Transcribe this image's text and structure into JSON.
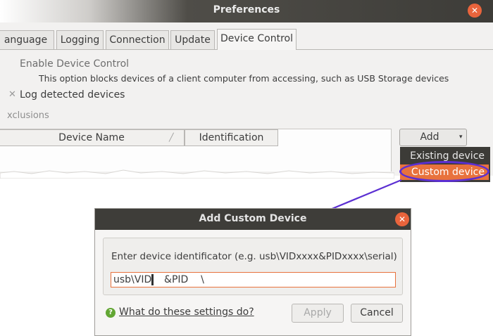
{
  "preferences": {
    "title": "Preferences",
    "close_glyph": "✕",
    "tabs": [
      {
        "label": "anguage"
      },
      {
        "label": "Logging"
      },
      {
        "label": "Connection"
      },
      {
        "label": "Update"
      },
      {
        "label": "Device Control",
        "active": true
      }
    ],
    "enable_label": "Enable Device Control",
    "enable_description": "This option blocks devices of a client computer from accessing, such as USB Storage devices",
    "log_checkbox_glyph": "✕",
    "log_label": "Log detected devices",
    "exclusions_label": "xclusions",
    "table_columns": [
      "Device Name",
      "Identification"
    ],
    "sort_glyph": "╱",
    "add_button": {
      "label": "Add",
      "caret": "▾"
    },
    "add_menu": {
      "items": [
        "Existing device",
        "Custom device"
      ],
      "highlighted": "Custom device"
    }
  },
  "dialog": {
    "title": "Add Custom Device",
    "close_glyph": "✕",
    "prompt": "Enter device identificator (e.g. usb\\VIDxxxx&PIDxxxx\\serial)",
    "input_value": "usb\\VID    &PID    \\",
    "help_glyph": "?",
    "help_link": "What do these settings do?",
    "apply_label": "Apply",
    "cancel_label": "Cancel"
  },
  "colors": {
    "accent_orange": "#e8723d",
    "annotation_purple": "#5b2fd2",
    "titlebar_dark": "#3e3d39"
  }
}
